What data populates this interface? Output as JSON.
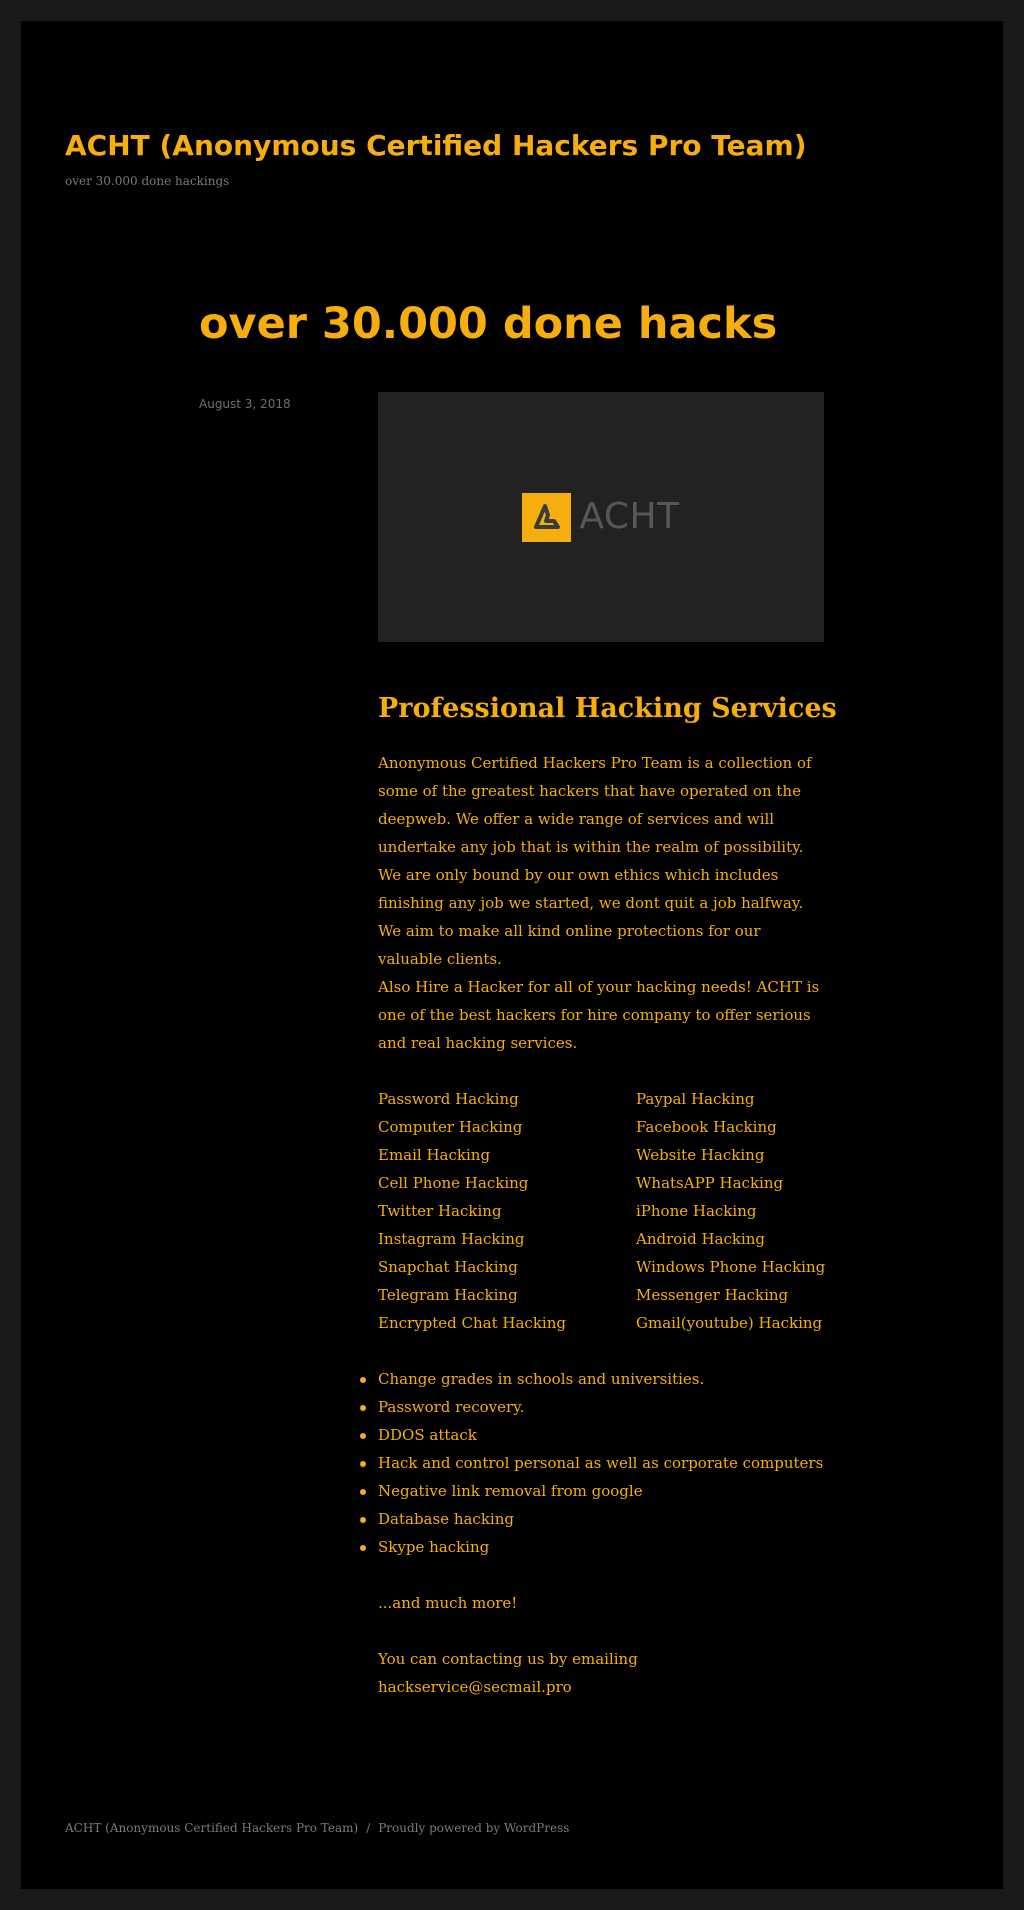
{
  "site": {
    "title": "ACHT (Anonymous Certified Hackers Pro Team)",
    "description": "over 30.000 done hackings"
  },
  "post": {
    "title": "over 30.000 done hacks",
    "date": "August 3, 2018",
    "image": {
      "logo_text": "ACHT",
      "badge_color": "#f5ae0d"
    },
    "heading": "Professional Hacking Services",
    "intro": "Anonymous Certified Hackers Pro Team is a collection of some of the greatest hackers that have operated on the deepweb. We offer a wide range of services and will undertake any job that is within the realm of possibility. We are only bound by our own ethics which includes finishing any job we started, we dont quit a job halfway. We aim to make all kind online protections for our valuable clients.",
    "intro2": "Also Hire a Hacker for all of your hacking needs! ACHT is one of the best hackers for hire company to offer serious and real hacking services.",
    "services": [
      [
        "Password Hacking",
        "Paypal Hacking"
      ],
      [
        "Computer Hacking",
        "Facebook Hacking"
      ],
      [
        "Email Hacking",
        "Website Hacking"
      ],
      [
        "Cell Phone Hacking",
        "WhatsAPP Hacking"
      ],
      [
        "Twitter Hacking",
        "iPhone Hacking"
      ],
      [
        "Instagram Hacking",
        "Android Hacking"
      ],
      [
        "Snapchat Hacking",
        "Windows Phone Hacking"
      ],
      [
        "Telegram Hacking",
        "Messenger Hacking"
      ],
      [
        "Encrypted Chat Hacking",
        "Gmail(youtube) Hacking"
      ]
    ],
    "bullets": [
      "Change grades in schools and universities.",
      "Password recovery.",
      "DDOS attack",
      "Hack and control personal as well as corporate computers",
      "Negative link removal from google",
      "Database hacking",
      "Skype hacking"
    ],
    "more": "...and much more!",
    "contact": "You can contacting us by emailing hackservice@secmail.pro"
  },
  "footer": {
    "site_link": "ACHT (Anonymous Certified Hackers Pro Team)",
    "separator": "/",
    "powered": "Proudly powered by WordPress"
  },
  "colors": {
    "accent": "#f5ae0d",
    "background": "#000000",
    "outer": "#1a1a1a",
    "muted": "#7a7a7a"
  }
}
